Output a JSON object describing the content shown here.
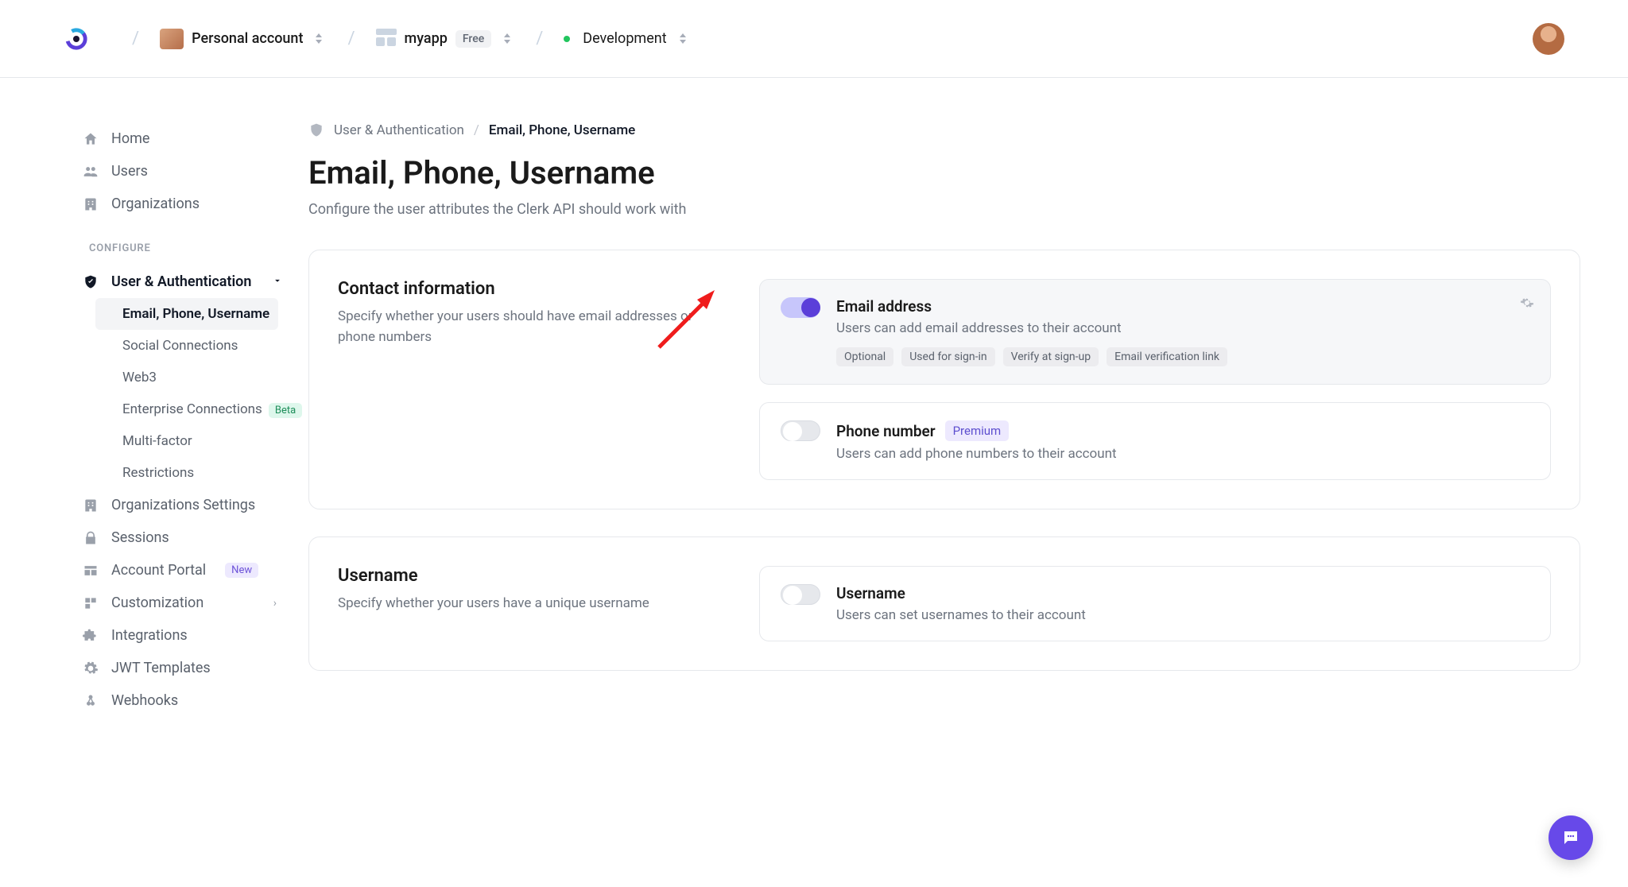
{
  "breadcrumb": {
    "account_label": "Personal account",
    "app_label": "myapp",
    "app_plan": "Free",
    "env_label": "Development"
  },
  "sidebar": {
    "primary": [
      {
        "icon": "home-icon",
        "label": "Home"
      },
      {
        "icon": "users-icon",
        "label": "Users"
      },
      {
        "icon": "building-icon",
        "label": "Organizations"
      }
    ],
    "section_configure": "CONFIGURE",
    "auth_group_label": "User & Authentication",
    "auth_sub": [
      {
        "label": "Email, Phone, Username",
        "active": true
      },
      {
        "label": "Social Connections"
      },
      {
        "label": "Web3"
      },
      {
        "label": "Enterprise Connections",
        "pill": "Beta"
      },
      {
        "label": "Multi-factor"
      },
      {
        "label": "Restrictions"
      }
    ],
    "rest": [
      {
        "icon": "building-icon",
        "label": "Organizations Settings"
      },
      {
        "icon": "lock-icon",
        "label": "Sessions"
      },
      {
        "icon": "portal-icon",
        "label": "Account Portal",
        "pill": "New"
      },
      {
        "icon": "custom-icon",
        "label": "Customization",
        "chevron": true
      },
      {
        "icon": "puzzle-icon",
        "label": "Integrations"
      },
      {
        "icon": "gear-icon",
        "label": "JWT Templates"
      },
      {
        "icon": "webhook-icon",
        "label": "Webhooks"
      }
    ]
  },
  "crumbs": {
    "parent": "User & Authentication",
    "current": "Email, Phone, Username"
  },
  "page": {
    "title": "Email, Phone, Username",
    "subtitle": "Configure the user attributes the Clerk API should work with"
  },
  "cards": {
    "contact": {
      "title": "Contact information",
      "desc": "Specify whether your users should have email addresses or phone numbers",
      "options": [
        {
          "key": "email",
          "on": true,
          "title": "Email address",
          "desc": "Users can add email addresses to their account",
          "tags": [
            "Optional",
            "Used for sign-in",
            "Verify at sign-up",
            "Email verification link"
          ],
          "gear": true,
          "highlight": true
        },
        {
          "key": "phone",
          "on": false,
          "title": "Phone number",
          "desc": "Users can add phone numbers to their account",
          "premium": "Premium"
        }
      ]
    },
    "username": {
      "title": "Username",
      "desc": "Specify whether your users have a unique username",
      "options": [
        {
          "key": "username",
          "on": false,
          "title": "Username",
          "desc": "Users can set usernames to their account"
        }
      ]
    }
  }
}
